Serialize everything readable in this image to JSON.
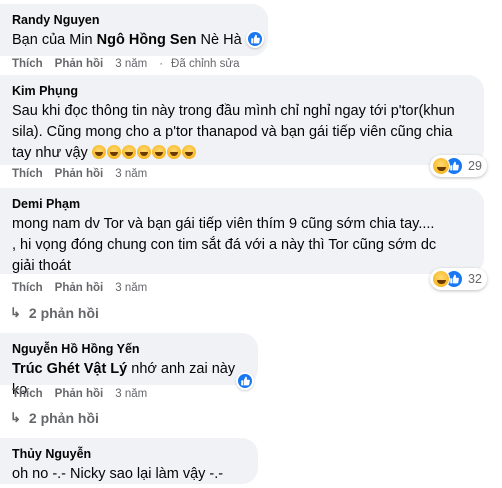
{
  "comments": [
    {
      "author": "Randy Nguyen",
      "text_pre": "Bạn của Min ",
      "text_bold": "Ngô Hồng Sen",
      "text_post": " Nè Hà",
      "actions": {
        "like": "Thích",
        "reply": "Phản hồi",
        "time": "3 năm",
        "edited": "Đã chỉnh sửa"
      },
      "reactions": [
        "like-icon"
      ]
    },
    {
      "author": "Kim Phụng",
      "text": "Sau khi đọc thông tin này trong đầu mình chỉ nghỉ ngay tới p'tor(khun sila). Cũng mong cho a p'tor thanapod và bạn gái tiếp viên cũng chia tay như vậy",
      "emoji_count": 7,
      "actions": {
        "like": "Thích",
        "reply": "Phản hồi",
        "time": "3 năm"
      },
      "reactions": [
        "haha-icon",
        "like-icon"
      ],
      "reaction_count": "29"
    },
    {
      "author": "Demi Phạm",
      "text": "mong nam dv Tor và bạn gái tiếp viên thím 9 cũng sớm chia tay.... , hi vọng đóng chung con tim sắt đá với a này thì Tor cũng sớm dc giải thoát",
      "actions": {
        "like": "Thích",
        "reply": "Phản hồi",
        "time": "3 năm"
      },
      "reactions": [
        "haha-icon",
        "like-icon"
      ],
      "reaction_count": "32",
      "replies": "2 phản hồi"
    },
    {
      "author": "Nguyễn Hồ Hồng Yến",
      "text_bold": "Trúc Ghét Vật Lý",
      "text_post": " nhớ anh zai này ko",
      "actions": {
        "like": "Thích",
        "reply": "Phản hồi",
        "time": "3 năm"
      },
      "reactions": [
        "like-icon"
      ],
      "replies": "2 phản hồi"
    },
    {
      "author": "Thủy Nguyễn",
      "text": "oh no -.- Nicky sao lại làm vậy -.-"
    }
  ],
  "colors": {
    "bubble": "#f0f2f5",
    "meta": "#65676b",
    "like_blue": "#1877f2"
  }
}
